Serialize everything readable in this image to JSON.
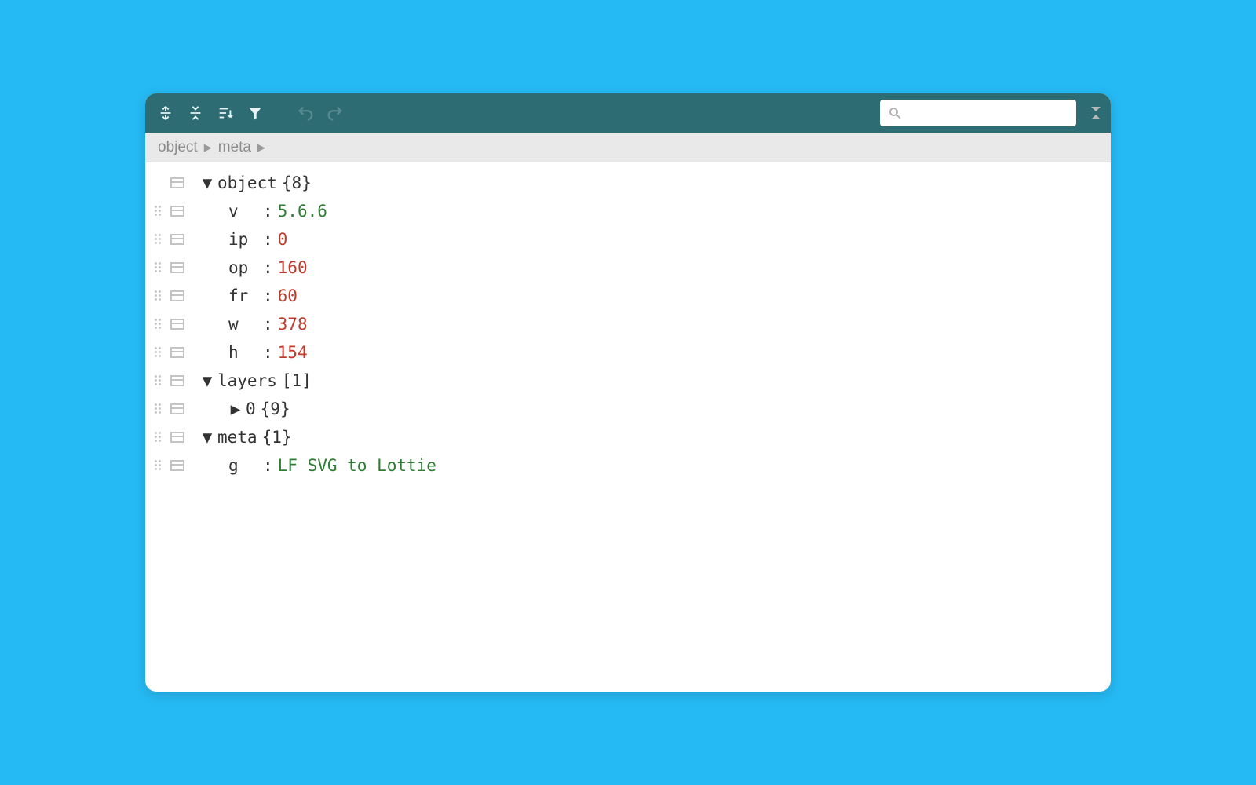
{
  "toolbar": {
    "undo_label": "↺",
    "redo_label": "↻"
  },
  "breadcrumb": {
    "a": "object",
    "b": "meta"
  },
  "search": {
    "placeholder": ""
  },
  "tree": {
    "root": {
      "key": "object",
      "meta": "{8}"
    },
    "kv": [
      {
        "key": "v",
        "val": "5.6.6",
        "kind": "str"
      },
      {
        "key": "ip",
        "val": "0",
        "kind": "num"
      },
      {
        "key": "op",
        "val": "160",
        "kind": "num"
      },
      {
        "key": "fr",
        "val": "60",
        "kind": "num"
      },
      {
        "key": "w",
        "val": "378",
        "kind": "num"
      },
      {
        "key": "h",
        "val": "154",
        "kind": "num"
      }
    ],
    "layers": {
      "key": "layers",
      "meta": "[1]"
    },
    "layers_child": {
      "key": "0",
      "meta": "{9}"
    },
    "meta": {
      "key": "meta",
      "meta": "{1}"
    },
    "meta_g": {
      "key": "g",
      "val": "LF SVG to Lottie",
      "kind": "str"
    }
  }
}
